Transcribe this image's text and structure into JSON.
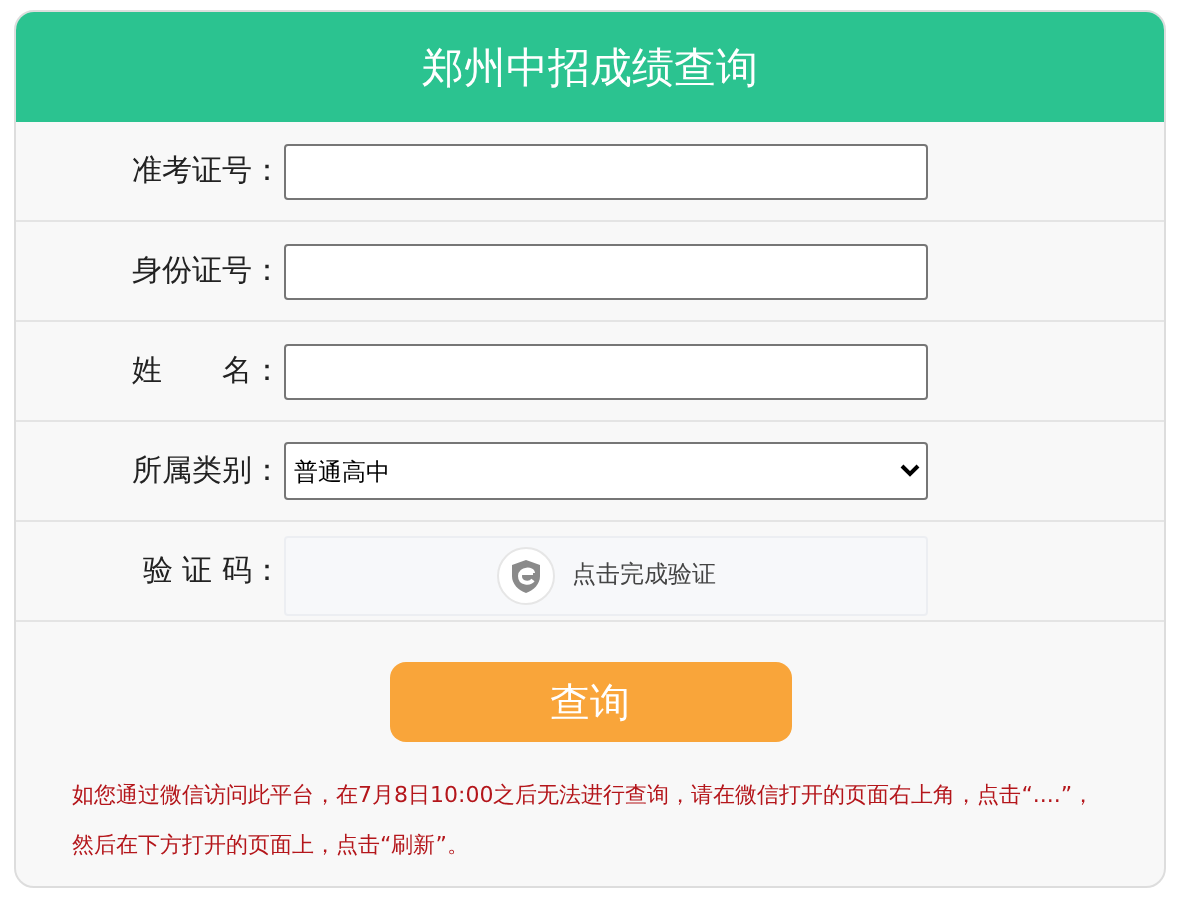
{
  "title": "郑州中招成绩查询",
  "rows": [
    {
      "label": "准考证号：",
      "kind": "text"
    },
    {
      "label": "身份证号：",
      "kind": "text"
    },
    {
      "label": "姓　　名：",
      "kind": "text"
    },
    {
      "label": "所属类别：",
      "kind": "select",
      "value": "普通高中"
    },
    {
      "label": "验 证 码：",
      "kind": "captcha",
      "value": "点击完成验证"
    }
  ],
  "submit": "查询",
  "note": "如您通过微信访问此平台，在7月8日10:00之后无法进行查询，请在微信打开的页面右上角，点击“....”，然后在下方打开的页面上，点击“刷新”。"
}
